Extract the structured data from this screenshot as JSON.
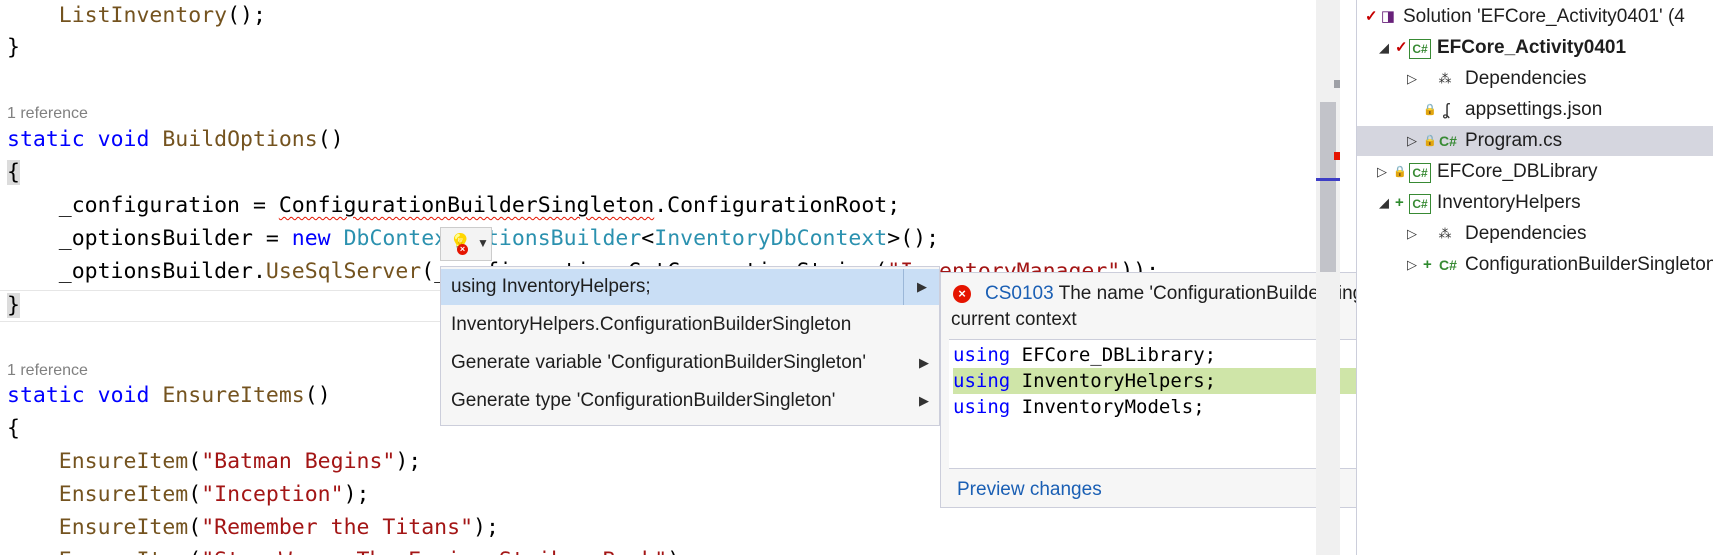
{
  "editor": {
    "lines": [
      {
        "segments": [
          {
            "t": "    "
          },
          {
            "t": "ListInventory",
            "c": "fn"
          },
          {
            "t": "();"
          }
        ]
      },
      {
        "segments": [
          {
            "t": "}"
          }
        ]
      },
      {
        "segments": [
          {
            "t": "static",
            "c": "kw"
          },
          {
            "t": " "
          },
          {
            "t": "void",
            "c": "kw"
          },
          {
            "t": " "
          },
          {
            "t": "BuildOptions",
            "c": "fn"
          },
          {
            "t": "()"
          }
        ]
      },
      {
        "segments": [
          {
            "t": "{",
            "c": "bh"
          }
        ]
      },
      {
        "segments": [
          {
            "t": "    _configuration = "
          },
          {
            "t": "ConfigurationBuilderSingleton",
            "c": "sq"
          },
          {
            "t": ".ConfigurationRoot;"
          }
        ]
      },
      {
        "segments": [
          {
            "t": "    _optionsBuilder = "
          },
          {
            "t": "new",
            "c": "kw"
          },
          {
            "t": " "
          },
          {
            "t": "DbContextOptionsBuilder",
            "c": "ty"
          },
          {
            "t": "<"
          },
          {
            "t": "InventoryDbContext",
            "c": "ty"
          },
          {
            "t": ">();"
          }
        ]
      },
      {
        "segments": [
          {
            "t": "    _optionsBuilder."
          },
          {
            "t": "UseSqlServer",
            "c": "fn"
          },
          {
            "t": "(_configuration.GetConnectionString("
          },
          {
            "t": "\"InventoryManager\"",
            "c": "st"
          },
          {
            "t": "));"
          }
        ]
      },
      {
        "segments": [
          {
            "t": "}",
            "c": "bh"
          }
        ]
      },
      {
        "segments": [
          {
            "t": "static",
            "c": "kw"
          },
          {
            "t": " "
          },
          {
            "t": "void",
            "c": "kw"
          },
          {
            "t": " "
          },
          {
            "t": "EnsureItems",
            "c": "fn"
          },
          {
            "t": "()"
          }
        ]
      },
      {
        "segments": [
          {
            "t": "{"
          }
        ]
      },
      {
        "segments": [
          {
            "t": "    "
          },
          {
            "t": "EnsureItem",
            "c": "fn"
          },
          {
            "t": "("
          },
          {
            "t": "\"Batman Begins\"",
            "c": "st"
          },
          {
            "t": ");"
          }
        ]
      },
      {
        "segments": [
          {
            "t": "    "
          },
          {
            "t": "EnsureItem",
            "c": "fn"
          },
          {
            "t": "("
          },
          {
            "t": "\"Inception\"",
            "c": "st"
          },
          {
            "t": ");"
          }
        ]
      },
      {
        "segments": [
          {
            "t": "    "
          },
          {
            "t": "EnsureItem",
            "c": "fn"
          },
          {
            "t": "("
          },
          {
            "t": "\"Remember the Titans\"",
            "c": "st"
          },
          {
            "t": ");"
          }
        ]
      },
      {
        "segments": [
          {
            "t": "    "
          },
          {
            "t": "EnsureItem",
            "c": "fn"
          },
          {
            "t": "("
          },
          {
            "t": "\"Star Wars: The Empire Strikes Back\"",
            "c": "st"
          },
          {
            "t": ");"
          }
        ]
      }
    ],
    "codelens": [
      "1 reference",
      "1 reference"
    ]
  },
  "quick_actions": {
    "items": [
      {
        "label": "using InventoryHelpers;",
        "has_submenu": true,
        "selected": true
      },
      {
        "label": "InventoryHelpers.ConfigurationBuilderSingleton",
        "has_submenu": false,
        "selected": false
      },
      {
        "label": "Generate variable 'ConfigurationBuilderSingleton'",
        "has_submenu": true,
        "selected": false
      },
      {
        "label": "Generate type 'ConfigurationBuilderSingleton'",
        "has_submenu": true,
        "selected": false
      }
    ]
  },
  "preview": {
    "error_code": "CS0103",
    "error_message": "The name 'ConfigurationBuilderSingleton' does not exist in the current context",
    "code_lines": [
      {
        "kw": "using",
        "rest": " EFCore_DBLibrary;",
        "added": false
      },
      {
        "kw": "using",
        "rest": " InventoryHelpers;",
        "added": true
      },
      {
        "kw": "using",
        "rest": " InventoryModels;",
        "added": false
      }
    ],
    "link": "Preview changes"
  },
  "solution_explorer": {
    "rows": [
      {
        "label": "Solution 'EFCore_Activity0401' (4",
        "icon": "sln",
        "bold": false
      },
      {
        "label": "EFCore_Activity0401",
        "icon": "cs-proj",
        "bold": true
      },
      {
        "label": "Dependencies",
        "icon": "deps",
        "bold": false
      },
      {
        "label": "appsettings.json",
        "icon": "json",
        "bold": false
      },
      {
        "label": "Program.cs",
        "icon": "cs-file",
        "bold": false
      },
      {
        "label": "EFCore_DBLibrary",
        "icon": "cs-proj",
        "bold": false
      },
      {
        "label": "InventoryHelpers",
        "icon": "cs-proj",
        "bold": false
      },
      {
        "label": "Dependencies",
        "icon": "deps",
        "bold": false
      },
      {
        "label": "ConfigurationBuilderSingleton.cs",
        "icon": "cs-file",
        "bold": false
      }
    ]
  }
}
